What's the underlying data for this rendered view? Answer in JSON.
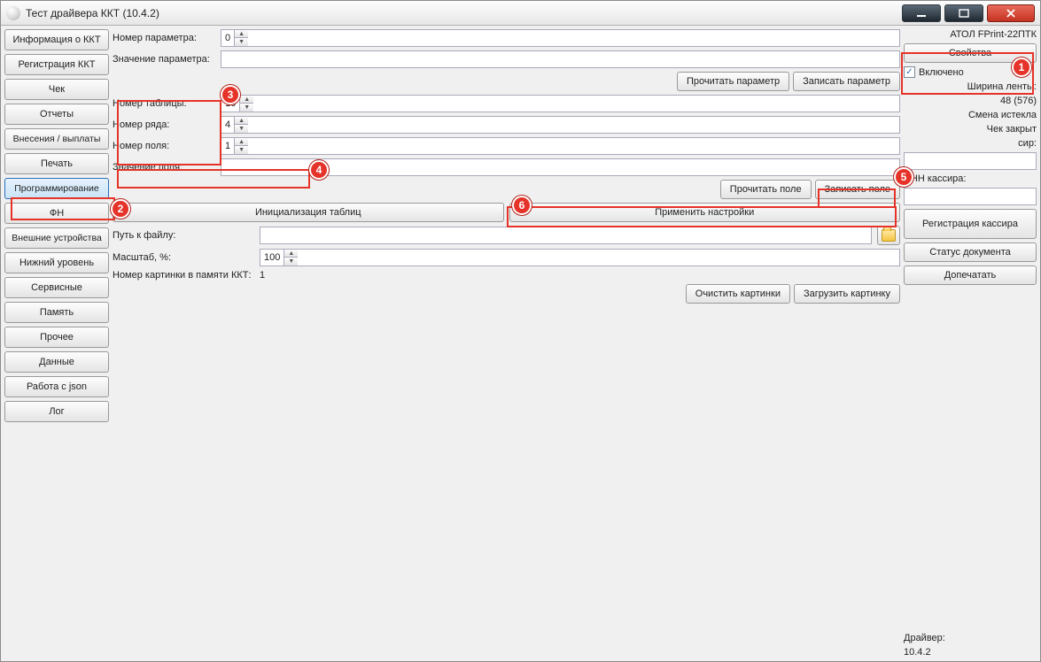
{
  "window": {
    "title": "Тест драйвера ККТ (10.4.2)"
  },
  "sidebar": {
    "items": [
      "Информация о ККТ",
      "Регистрация ККТ",
      "Чек",
      "Отчеты",
      "Внесения / выплаты",
      "Печать",
      "Программирование",
      "ФН",
      "Внешние устройства",
      "Нижний уровень",
      "Сервисные",
      "Память",
      "Прочее",
      "Данные",
      "Работа с json",
      "Лог"
    ],
    "active_index": 6
  },
  "center": {
    "param_number_label": "Номер параметра:",
    "param_number_value": "0",
    "param_value_label": "Значение параметра:",
    "param_value_value": "",
    "read_param_btn": "Прочитать параметр",
    "write_param_btn": "Записать параметр",
    "table_number_label": "Номер таблицы:",
    "table_number_value": "10",
    "row_number_label": "Номер ряда:",
    "row_number_value": "4",
    "field_number_label": "Номер поля:",
    "field_number_value": "1",
    "field_value_label": "Значение поля:",
    "field_value_value": "",
    "read_field_btn": "Прочитать поле",
    "write_field_btn": "Записать поле",
    "init_tables_btn": "Инициализация таблиц",
    "apply_settings_btn": "Применить настройки",
    "file_path_label": "Путь к файлу:",
    "file_path_value": "",
    "scale_label": "Масштаб, %:",
    "scale_value": "100",
    "img_number_label": "Номер картинки в памяти ККТ:",
    "img_number_value": "1",
    "clear_images_btn": "Очистить картинки",
    "load_image_btn": "Загрузить картинку"
  },
  "right": {
    "device": "АТОЛ FPrint-22ПТК",
    "properties_btn": "Свойства",
    "enabled_label": "Включено",
    "tape_width_label": "Ширина ленты:",
    "tape_width_value": "48 (576)",
    "shift_status": "Смена истекла",
    "check_status": "Чек закрыт",
    "sir_label": "сир:",
    "cashier_inn_label": "ИНН кассира:",
    "register_cashier_btn": "Регистрация кассира",
    "doc_status_btn": "Статус документа",
    "reprint_btn": "Допечатать",
    "driver_label": "Драйвер:",
    "driver_version": "10.4.2"
  },
  "callouts": {
    "m1": "1",
    "m2": "2",
    "m3": "3",
    "m4": "4",
    "m5": "5",
    "m6": "6"
  }
}
